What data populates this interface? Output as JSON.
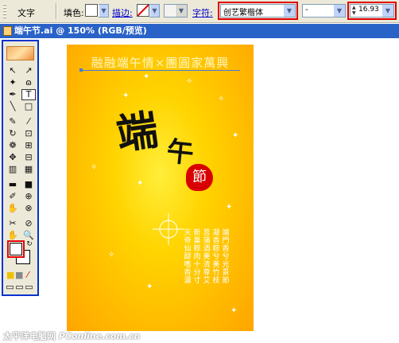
{
  "control_bar": {
    "mode_label": "文字",
    "fill_label": "填色:",
    "stroke_label": "描边:",
    "char_label": "字符:",
    "font_family": "创艺繁楷体",
    "font_style": "-",
    "font_size": "16.93 pt",
    "dropdown_arrow": "▼"
  },
  "document": {
    "title": "端午节.ai @ 150% (RGB/预览)"
  },
  "toolbox": {
    "tools": [
      "↖",
      "↗",
      "✦",
      "ɷ",
      "✒",
      "T",
      "╲",
      "□",
      "✎",
      "⁄",
      "↻",
      "⊡",
      "❁",
      "⊞",
      "✥",
      "⊟",
      "▥",
      "▦",
      "▬",
      "■",
      "✐",
      "⊕",
      "✋",
      "⊗",
      "✂",
      "⊘",
      "✋",
      "🔍"
    ],
    "small_swatches": [
      "■",
      "■",
      "⁄"
    ],
    "screen_modes": [
      "▭",
      "▭",
      "▭"
    ]
  },
  "artwork": {
    "headline": "融融端午情×團圓家萬興",
    "big_text_1": "端",
    "big_text_2": "午",
    "seal_text": "節",
    "poem_columns": [
      "天帝仙醪嗜香濃",
      "新巢粽肉十分寸",
      "莒蒲酒美清尊艾",
      "凝香粽兮美竹枝",
      "端門香兮光景節"
    ]
  },
  "watermark": {
    "site_cn": "太平洋电脑网",
    "site_en": "PConline.com.cn"
  },
  "colors": {
    "highlight_red": "#e00000",
    "title_blue": "#2a63c8",
    "toolbox_border": "#0033cc",
    "artboard_gold": "#ffc000"
  }
}
